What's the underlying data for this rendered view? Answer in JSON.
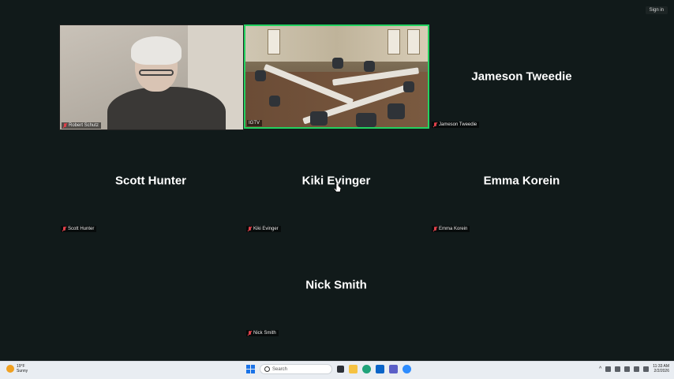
{
  "header": {
    "sign_in": "Sign in"
  },
  "participants": [
    {
      "display": "Robert Schutz",
      "label": "Robert Schutz",
      "has_video": true
    },
    {
      "display": "",
      "label": "IGTV",
      "has_video": true,
      "active": true
    },
    {
      "display": "Jameson Tweedie",
      "label": "Jameson Tweedie",
      "has_video": false
    },
    {
      "display": "Scott Hunter",
      "label": "Scott Hunter",
      "has_video": false
    },
    {
      "display": "Kiki Evinger",
      "label": "Kiki Evinger",
      "has_video": false
    },
    {
      "display": "Emma Korein",
      "label": "Emma Korein",
      "has_video": false
    },
    {
      "display": "Nick Smith",
      "label": "Nick Smith",
      "has_video": false
    }
  ],
  "taskbar": {
    "weather_temp": "19°F",
    "weather_desc": "Sunny",
    "search_placeholder": "Search",
    "time": "11:33 AM",
    "date": "2/2/2026"
  },
  "colors": {
    "active_border": "#23d160",
    "muted_mic": "#e0404a",
    "background": "#111a1a"
  },
  "icons": [
    "mic-muted-icon",
    "windows-start-icon",
    "search-icon",
    "task-view-icon",
    "file-explorer-icon",
    "edge-icon",
    "outlook-icon",
    "teams-icon",
    "zoom-icon",
    "chevron-up-icon",
    "wifi-icon",
    "volume-icon",
    "battery-icon"
  ]
}
